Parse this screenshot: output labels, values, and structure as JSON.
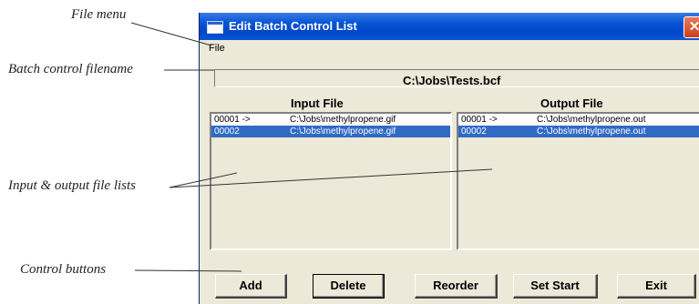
{
  "callouts": {
    "file_menu": "File menu",
    "filename": "Batch control filename",
    "file_lists": "Input & output file lists",
    "control_buttons": "Control buttons"
  },
  "window": {
    "title": "Edit Batch Control List",
    "close_glyph": "✕"
  },
  "menu": {
    "file": "File"
  },
  "batch_filename": "C:\\Jobs\\Tests.bcf",
  "input_list": {
    "header": "Input File",
    "rows": [
      {
        "num": "00001 ->",
        "path": "C:\\Jobs\\methylpropene.gif",
        "selected": false
      },
      {
        "num": "00002",
        "path": "C:\\Jobs\\methylpropene.gif",
        "selected": true
      }
    ]
  },
  "output_list": {
    "header": "Output File",
    "rows": [
      {
        "num": "00001 ->",
        "path": "C:\\Jobs\\methylpropene.out",
        "selected": false
      },
      {
        "num": "00002",
        "path": "C:\\Jobs\\methylpropene.out",
        "selected": true
      }
    ]
  },
  "buttons": {
    "add": "Add",
    "delete": "Delete",
    "reorder": "Reorder",
    "set_start": "Set Start",
    "exit": "Exit"
  },
  "colors": {
    "titlebar": "#0a56d6",
    "selection": "#316ac5",
    "dialog_bg": "#ece9d8",
    "close_button": "#d6532f"
  }
}
